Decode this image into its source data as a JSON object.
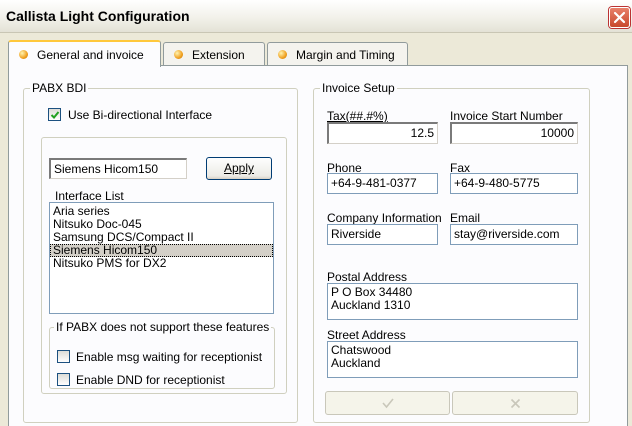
{
  "window": {
    "title": "Callista Light Configuration"
  },
  "tabs": [
    {
      "label": "General and invoice"
    },
    {
      "label": "Extension"
    },
    {
      "label": "Margin and Timing"
    }
  ],
  "pabx": {
    "group_title": "PABX BDI",
    "use_bdi_label": "Use Bi-directional Interface",
    "use_bdi_checked": true,
    "selected_interface": "Siemens Hicom150",
    "apply_label": "Apply",
    "interface_list_label": "Interface List",
    "interface_items": [
      "Aria series",
      "Nitsuko Doc-045",
      "Samsung DCS/Compact II",
      "Siemens Hicom150",
      "Nitsuko PMS for DX2"
    ],
    "selected_index": 3,
    "features_group_title": "If PABX does not support these features",
    "msg_waiting_label": "Enable msg waiting for receptionist",
    "msg_waiting_checked": false,
    "dnd_label": "Enable DND for receptionist",
    "dnd_checked": false
  },
  "invoice": {
    "group_title": "Invoice Setup",
    "tax_label": "Tax(##.#%)",
    "tax_value": "12.5",
    "start_number_label": "Invoice Start Number",
    "start_number_value": "10000",
    "phone_label": "Phone",
    "phone_value": "+64-9-481-0377",
    "fax_label": "Fax",
    "fax_value": "+64-9-480-5775",
    "company_label": "Company Information",
    "company_value": "Riverside",
    "email_label": "Email",
    "email_value": "stay@riverside.com",
    "postal_label": "Postal Address",
    "postal_lines": [
      "P O Box 34480",
      "Auckland 1310"
    ],
    "street_label": "Street Address",
    "street_lines": [
      "Chatswood",
      "Auckland"
    ]
  },
  "icons": {
    "ok": "check-icon",
    "cancel": "x-icon",
    "close": "close-icon",
    "tab": "tab-dot-icon"
  },
  "colors": {
    "window_bg": "#ECE9D8",
    "panel_bg": "#FCFCFE",
    "tab_highlight": "#FFC83C",
    "close_red": "#C8482C",
    "selection_bg": "#D4D0C8"
  }
}
